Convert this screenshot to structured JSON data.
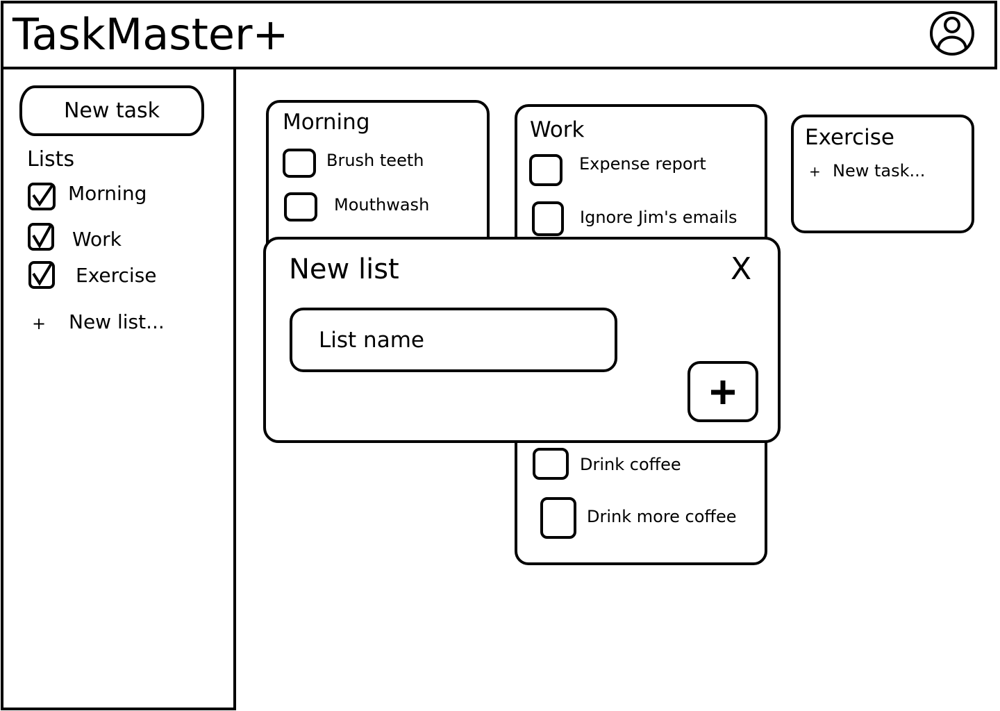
{
  "header": {
    "title": "TaskMaster+",
    "avatar_icon": "user-circle-icon"
  },
  "sidebar": {
    "new_task_label": "New task",
    "lists_heading": "Lists",
    "lists": [
      {
        "label": "Morning",
        "checked": true
      },
      {
        "label": "Work",
        "checked": true
      },
      {
        "label": "Exercise",
        "checked": true
      }
    ],
    "new_list_plus": "+",
    "new_list_label": "New list..."
  },
  "cards": {
    "morning": {
      "title": "Morning",
      "tasks": [
        "Brush teeth",
        "Mouthwash"
      ]
    },
    "work": {
      "title": "Work",
      "tasks": [
        "Expense report",
        "Ignore Jim's emails",
        "Drink coffee",
        "Drink more coffee"
      ]
    },
    "exercise": {
      "title": "Exercise",
      "add_plus": "+",
      "add_label": "New task..."
    }
  },
  "modal": {
    "title": "New list",
    "close_label": "X",
    "input_placeholder": "List name",
    "add_icon": "plus-icon"
  }
}
